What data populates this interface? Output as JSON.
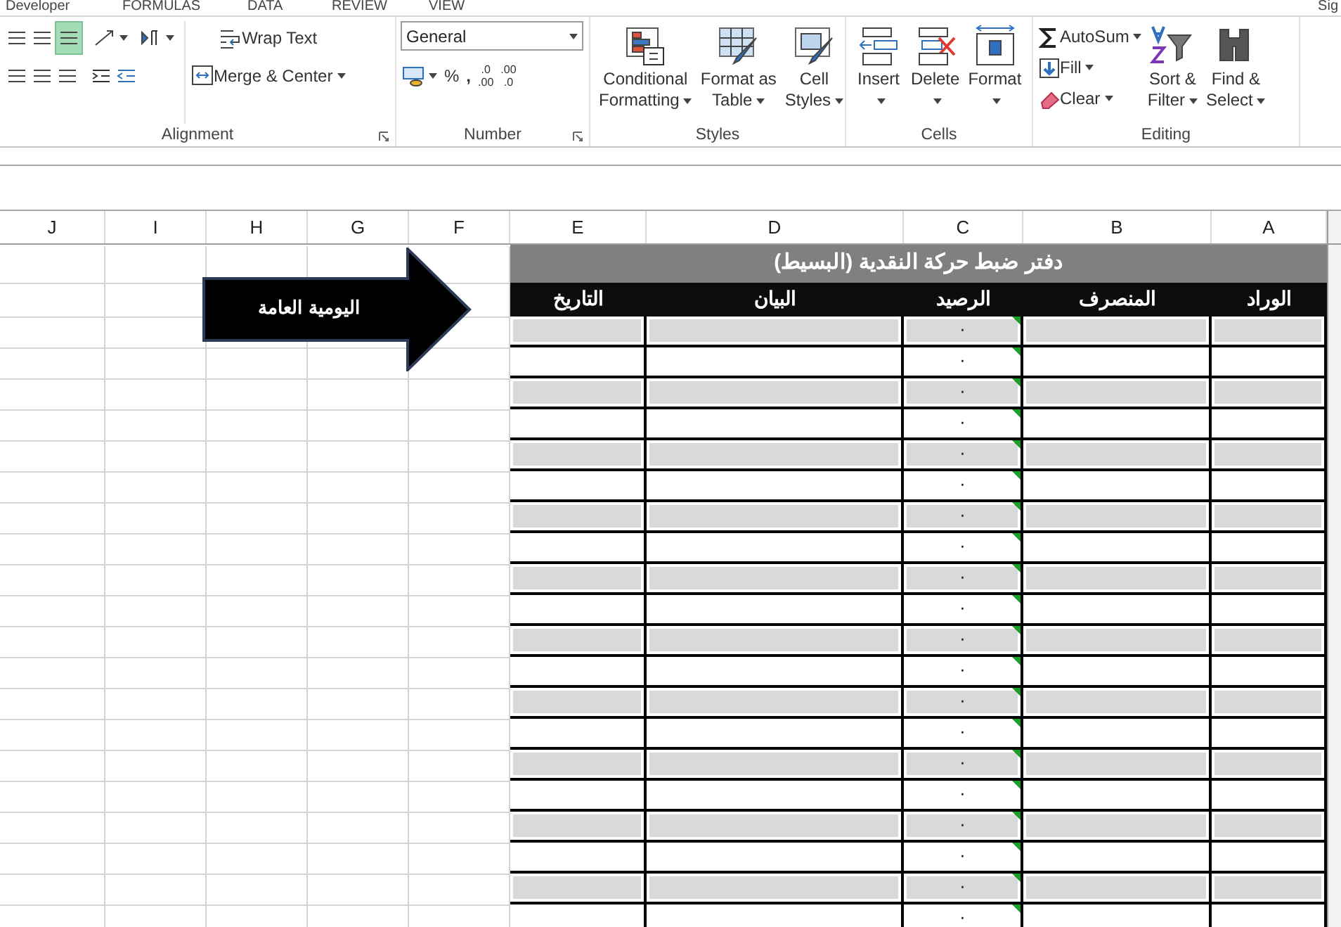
{
  "tabs": [
    {
      "label": "Developer"
    },
    {
      "label": "FORMULAS"
    },
    {
      "label": "DATA"
    },
    {
      "label": "REVIEW"
    },
    {
      "label": "VIEW"
    }
  ],
  "account": "Sig",
  "ribbon": {
    "alignment": {
      "label": "Alignment",
      "align_buttons": [
        {
          "selected": false
        },
        {
          "selected": false
        },
        {
          "selected": true
        }
      ],
      "wrap_text": "Wrap Text",
      "merge_center": "Merge & Center"
    },
    "number": {
      "label": "Number",
      "format": "General",
      "percent": "%",
      "comma": ",",
      "increase_decimal": [
        ".0",
        ".00"
      ],
      "decrease_decimal": [
        ".00",
        ".0"
      ]
    },
    "styles": {
      "label": "Styles",
      "buttons": [
        {
          "lines": [
            "Conditional",
            "Formatting"
          ]
        },
        {
          "lines": [
            "Format as",
            "Table"
          ]
        },
        {
          "lines": [
            "Cell",
            "Styles"
          ]
        }
      ]
    },
    "cells": {
      "label": "Cells",
      "buttons": [
        {
          "label": "Insert"
        },
        {
          "label": "Delete"
        },
        {
          "label": "Format"
        }
      ]
    },
    "editing": {
      "label": "Editing",
      "small": [
        {
          "label": "AutoSum"
        },
        {
          "label": "Fill"
        },
        {
          "label": "Clear"
        }
      ],
      "big": [
        {
          "lines": [
            "Sort &",
            "Filter"
          ]
        },
        {
          "lines": [
            "Find &",
            "Select"
          ]
        }
      ]
    }
  },
  "columns": [
    "J",
    "I",
    "H",
    "G",
    "F",
    "E",
    "D",
    "C",
    "B",
    "A"
  ],
  "arrow_shape": {
    "text": "اليومية العامة"
  },
  "ledger": {
    "title": "دفتر ضبط حركة النقدية (البسيط)",
    "headers": [
      "الوراد",
      "المنصرف",
      "الرصيد",
      "البيان",
      "التاريخ"
    ],
    "rows": [
      {
        "shaded": true,
        "balance": "٠",
        "error_flag": true
      },
      {
        "shaded": false,
        "balance": "٠",
        "error_flag": true
      },
      {
        "shaded": true,
        "balance": "٠",
        "error_flag": true
      },
      {
        "shaded": false,
        "balance": "٠",
        "error_flag": true
      },
      {
        "shaded": true,
        "balance": "٠",
        "error_flag": true
      },
      {
        "shaded": false,
        "balance": "٠",
        "error_flag": true
      },
      {
        "shaded": true,
        "balance": "٠",
        "error_flag": true
      },
      {
        "shaded": false,
        "balance": "٠",
        "error_flag": true
      },
      {
        "shaded": true,
        "balance": "٠",
        "error_flag": true
      },
      {
        "shaded": false,
        "balance": "٠",
        "error_flag": true
      },
      {
        "shaded": true,
        "balance": "٠",
        "error_flag": true
      },
      {
        "shaded": false,
        "balance": "٠",
        "error_flag": true
      },
      {
        "shaded": true,
        "balance": "٠",
        "error_flag": true
      },
      {
        "shaded": false,
        "balance": "٠",
        "error_flag": true
      },
      {
        "shaded": true,
        "balance": "٠",
        "error_flag": true
      },
      {
        "shaded": false,
        "balance": "٠",
        "error_flag": true
      },
      {
        "shaded": true,
        "balance": "٠",
        "error_flag": true
      },
      {
        "shaded": false,
        "balance": "٠",
        "error_flag": true
      },
      {
        "shaded": true,
        "balance": "٠",
        "error_flag": true
      },
      {
        "shaded": false,
        "balance": "٠",
        "error_flag": true
      }
    ]
  }
}
